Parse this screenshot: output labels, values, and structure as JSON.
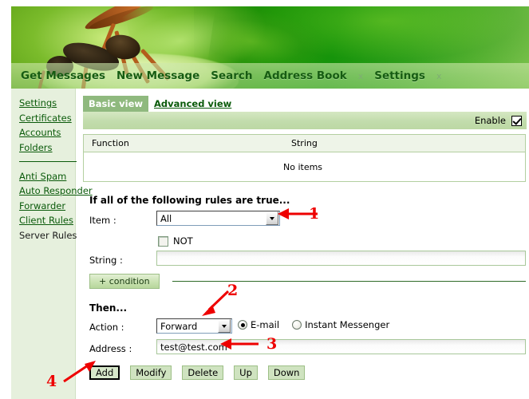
{
  "app": {
    "banner_alt": "wasp-on-leaf-banner"
  },
  "nav": {
    "items": [
      {
        "label": "Get Messages",
        "type": "link"
      },
      {
        "label": "New Message",
        "type": "link"
      },
      {
        "label": "Search",
        "type": "link"
      },
      {
        "label": "Address Book",
        "type": "link"
      },
      {
        "label": "x",
        "type": "separator"
      },
      {
        "label": "Settings",
        "type": "link"
      },
      {
        "label": "x",
        "type": "separator"
      }
    ]
  },
  "sidebar": {
    "group1": [
      {
        "label": "Settings",
        "active": false
      },
      {
        "label": "Certificates",
        "active": false
      },
      {
        "label": "Accounts",
        "active": false
      },
      {
        "label": "Folders",
        "active": false
      }
    ],
    "group2": [
      {
        "label": "Anti Spam",
        "active": false
      },
      {
        "label": "Auto Responder",
        "active": false
      },
      {
        "label": "Forwarder",
        "active": false
      },
      {
        "label": "Client Rules",
        "active": false
      },
      {
        "label": "Server Rules",
        "active": true
      }
    ]
  },
  "tabs": [
    {
      "label": "Basic view",
      "active": true
    },
    {
      "label": "Advanced view",
      "active": false
    }
  ],
  "enable": {
    "label": "Enable",
    "checked": true
  },
  "items_table": {
    "columns": [
      "Function",
      "String"
    ],
    "empty_text": "No items",
    "rows": []
  },
  "conditions": {
    "title": "If all of the following rules are true...",
    "item_label": "Item :",
    "item_value": "All",
    "not_label": "NOT",
    "not_checked": false,
    "string_label": "String :",
    "string_value": "",
    "add_condition_label": "+ condition"
  },
  "action": {
    "title": "Then...",
    "action_label": "Action :",
    "action_value": "Forward",
    "delivery_options": [
      {
        "label": "E-mail",
        "selected": true
      },
      {
        "label": "Instant Messenger",
        "selected": false
      }
    ],
    "address_label": "Address :",
    "address_value": "test@test.com"
  },
  "buttons": [
    {
      "label": "Add",
      "focused": true
    },
    {
      "label": "Modify",
      "focused": false
    },
    {
      "label": "Delete",
      "focused": false
    },
    {
      "label": "Up",
      "focused": false
    },
    {
      "label": "Down",
      "focused": false
    }
  ],
  "annotations": {
    "color": "#ee0000",
    "markers": [
      {
        "number": "1",
        "target": "item-dropdown",
        "direction": "left"
      },
      {
        "number": "2",
        "target": "action-dropdown",
        "direction": "down-left"
      },
      {
        "number": "3",
        "target": "address-input",
        "direction": "left"
      },
      {
        "number": "4",
        "target": "add-button",
        "direction": "up-right"
      }
    ]
  }
}
